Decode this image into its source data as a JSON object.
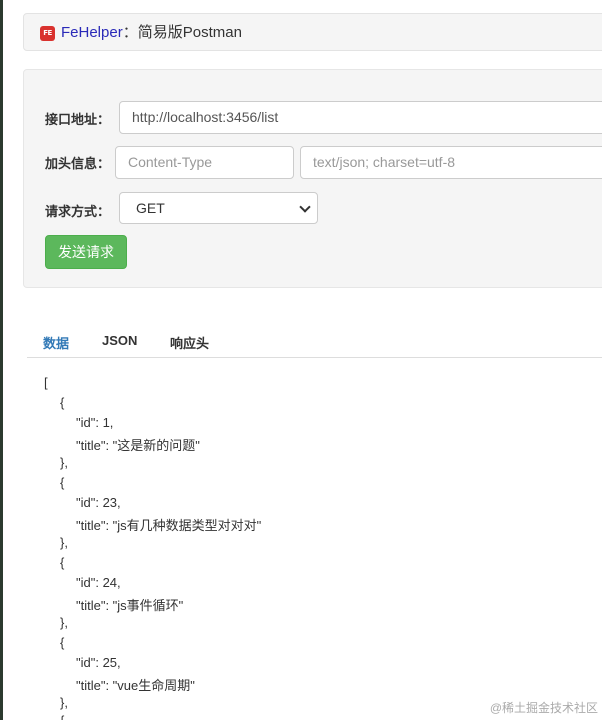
{
  "header": {
    "logo_text": "FE",
    "brand": "FeHelper",
    "separator": "：",
    "title": "简易版Postman"
  },
  "form": {
    "url_label": "接口地址：",
    "url_value": "http://localhost:3456/list",
    "header_label": "加头信息：",
    "header_key_placeholder": "Content-Type",
    "header_value_placeholder": "text/json; charset=utf-8",
    "method_label": "请求方式：",
    "method_value": "GET",
    "send_label": "发送请求"
  },
  "tabs": [
    "数据",
    "JSON",
    "响应头"
  ],
  "active_tab": "数据",
  "response": {
    "lines": [
      "[",
      "{",
      "\"id\": 1,",
      "\"title\": \"这是新的问题\"",
      "},",
      "{",
      "\"id\": 23,",
      "\"title\": \"js有几种数据类型对对对\"",
      "},",
      "{",
      "\"id\": 24,",
      "\"title\": \"js事件循环\"",
      "},",
      "{",
      "\"id\": 25,",
      "\"title\": \"vue生命周期\"",
      "},",
      "{"
    ]
  },
  "watermark": "@稀土掘金技术社区"
}
